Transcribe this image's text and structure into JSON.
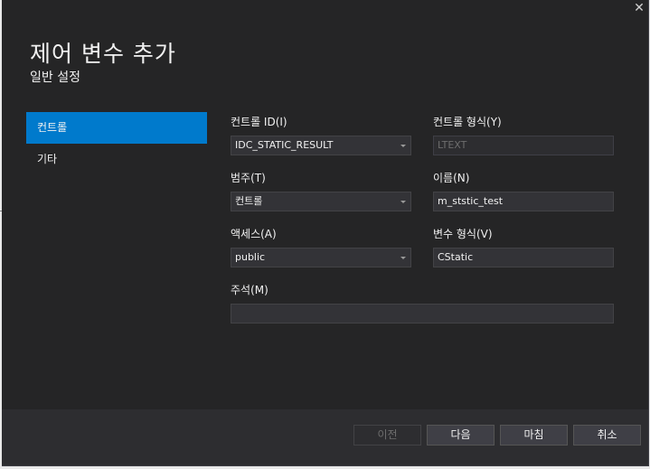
{
  "dialog": {
    "close_glyph": "✕",
    "title": "제어 변수 추가",
    "subtitle": "일반 설정"
  },
  "nav": {
    "items": [
      {
        "label": "컨트롤",
        "active": true
      },
      {
        "label": "기타",
        "active": false
      }
    ]
  },
  "form": {
    "control_id": {
      "label": "컨트롤 ID(I)",
      "value": "IDC_STATIC_RESULT"
    },
    "control_type": {
      "label": "컨트롤 형식(Y)",
      "value": "LTEXT"
    },
    "category": {
      "label": "범주(T)",
      "value": "컨트롤"
    },
    "name": {
      "label": "이름(N)",
      "value": "m_ststic_test"
    },
    "access": {
      "label": "액세스(A)",
      "value": "public"
    },
    "variable_type": {
      "label": "변수 형식(V)",
      "value": "CStatic"
    },
    "comment": {
      "label": "주석(M)",
      "value": ""
    }
  },
  "footer": {
    "back_label": "이전",
    "next_label": "다음",
    "finish_label": "마침",
    "cancel_label": "취소"
  },
  "colors": {
    "background": "#252526",
    "accent": "#007acc",
    "input_bg": "#333337",
    "footer_bg": "#2d2d30"
  }
}
